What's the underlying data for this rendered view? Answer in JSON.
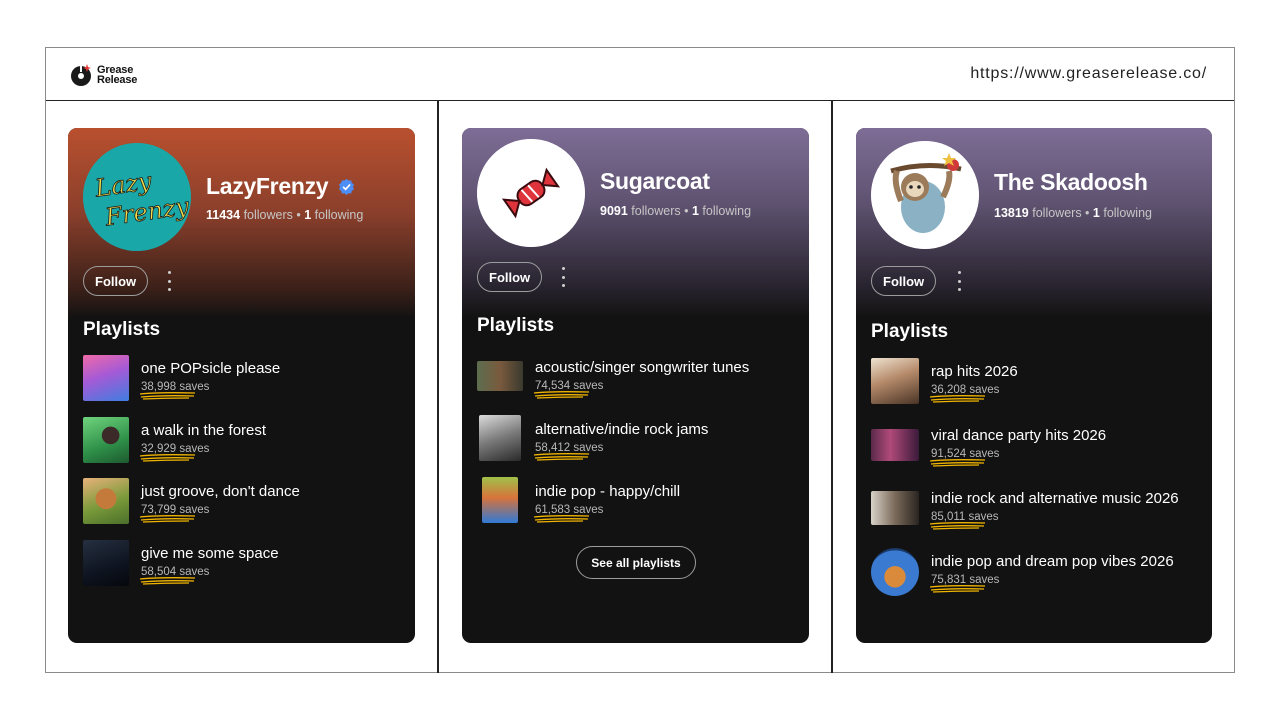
{
  "header": {
    "logo_line1": "Grease",
    "logo_line2": "Release",
    "url": "https://www.greaserelease.co/"
  },
  "colors": {
    "orange_gradient": "#b9502f",
    "purple_gradient": "#7e6d96",
    "card_bg": "#121212",
    "verified": "#4d8df6",
    "scribble": "#f0b400"
  },
  "cards": [
    {
      "name": "LazyFrenzy",
      "verified": true,
      "avatar_text": "Lazy Frenzy",
      "followers": "11434",
      "followers_label": "followers",
      "following": "1",
      "following_label": "following",
      "follow_label": "Follow",
      "playlists_heading": "Playlists",
      "playlists": [
        {
          "title": "one POPsicle please",
          "saves": "38,998 saves"
        },
        {
          "title": "a walk in the forest",
          "saves": "32,929 saves"
        },
        {
          "title": "just groove, don't dance",
          "saves": "73,799 saves"
        },
        {
          "title": "give me some space",
          "saves": "58,504 saves"
        }
      ]
    },
    {
      "name": "Sugarcoat",
      "verified": false,
      "followers": "9091",
      "followers_label": "followers",
      "following": "1",
      "following_label": "following",
      "follow_label": "Follow",
      "playlists_heading": "Playlists",
      "playlists": [
        {
          "title": "acoustic/singer songwriter tunes",
          "saves": "74,534 saves"
        },
        {
          "title": "alternative/indie rock jams",
          "saves": "58,412 saves"
        },
        {
          "title": "indie pop - happy/chill",
          "saves": "61,583 saves"
        }
      ],
      "see_all_label": "See all playlists"
    },
    {
      "name": "The Skadoosh",
      "verified": false,
      "followers": "13819",
      "followers_label": "followers",
      "following": "1",
      "following_label": "following",
      "follow_label": "Follow",
      "playlists_heading": "Playlists",
      "playlists": [
        {
          "title": "rap hits 2026",
          "saves": "36,208 saves"
        },
        {
          "title": "viral dance party hits 2026",
          "saves": "91,524 saves"
        },
        {
          "title": "indie rock and alternative music 2026",
          "saves": "85,011 saves"
        },
        {
          "title": "indie pop and dream pop vibes 2026",
          "saves": "75,831 saves"
        }
      ]
    }
  ]
}
